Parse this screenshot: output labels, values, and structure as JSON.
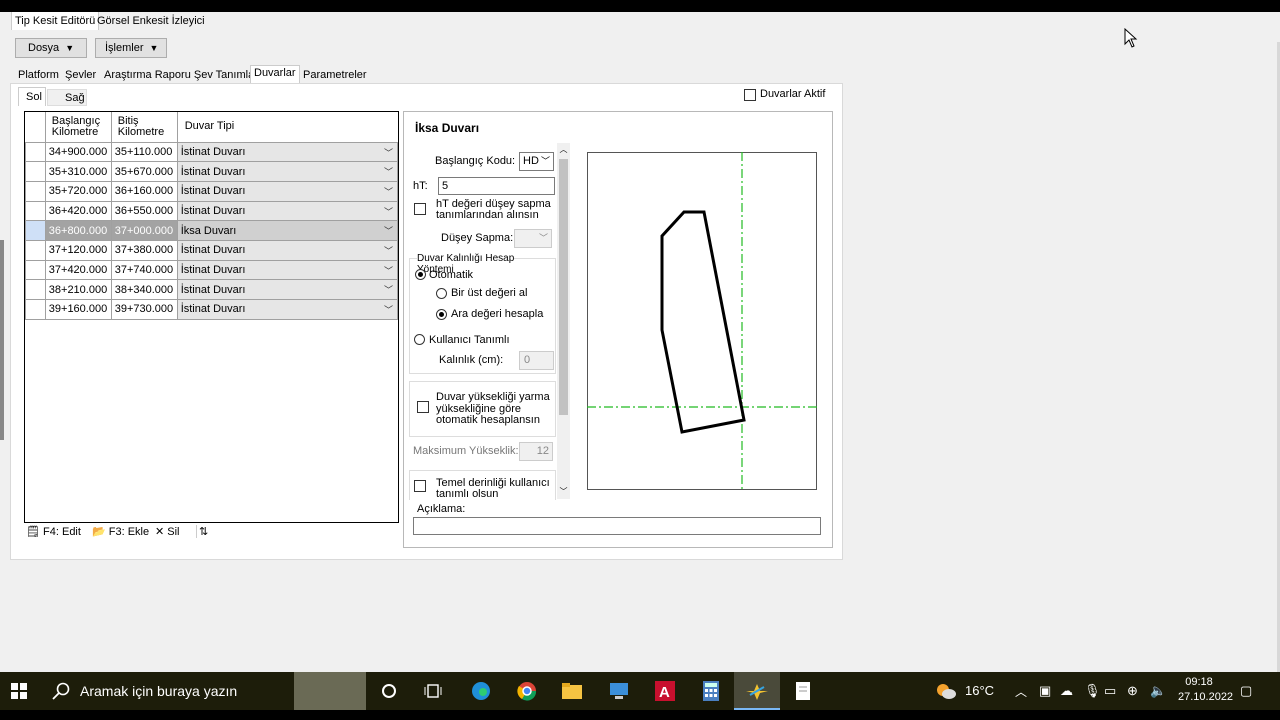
{
  "window_tabs": [
    "Tip Kesit Editörü",
    "Görsel Enkesit İzleyici"
  ],
  "toolbar": {
    "file": "Dosya",
    "actions": "İşlemler"
  },
  "section_tabs": [
    "Platform",
    "Şevler",
    "Araştırma Raporu Şev Tanımları",
    "Duvarlar",
    "Parametreler"
  ],
  "side_tabs": [
    "Sol",
    "Sağ"
  ],
  "walls_active_label": "Duvarlar Aktif",
  "grid": {
    "headers": {
      "start": "Başlangıç\nKilometre",
      "end": "Bitiş\nKilometre",
      "type": "Duvar Tipi"
    },
    "rows": [
      {
        "start": "34+900.000",
        "end": "35+110.000",
        "type": "İstinat Duvarı"
      },
      {
        "start": "35+310.000",
        "end": "35+670.000",
        "type": "İstinat Duvarı"
      },
      {
        "start": "35+720.000",
        "end": "36+160.000",
        "type": "İstinat Duvarı"
      },
      {
        "start": "36+420.000",
        "end": "36+550.000",
        "type": "İstinat Duvarı"
      },
      {
        "start": "36+800.000",
        "end": "37+000.000",
        "type": "İksa Duvarı"
      },
      {
        "start": "37+120.000",
        "end": "37+380.000",
        "type": "İstinat Duvarı"
      },
      {
        "start": "37+420.000",
        "end": "37+740.000",
        "type": "İstinat Duvarı"
      },
      {
        "start": "38+210.000",
        "end": "38+340.000",
        "type": "İstinat Duvarı"
      },
      {
        "start": "39+160.000",
        "end": "39+730.000",
        "type": "İstinat Duvarı"
      }
    ]
  },
  "grid_actions": {
    "edit": "F4: Edit",
    "add": "F3: Ekle",
    "delete": "Sil"
  },
  "editor": {
    "title": "İksa Duvarı",
    "start_code_label": "Başlangıç Kodu:",
    "start_code_value": "HD",
    "ht_label": "hT:",
    "ht_value": "5",
    "ht_from_vertical": "hT değeri düşey sapma\ntanımlarından alınsın",
    "vertical_offset_label": "Düşey Sapma:",
    "thickness_method_label": "Duvar Kalınlığı Hesap\nYöntemi",
    "auto_label": "Otomatik",
    "upper_value_label": "Bir üst değeri al",
    "interpolate_label": "Ara değeri hesapla",
    "user_defined_label": "Kullanıcı Tanımlı",
    "thickness_label": "Kalınlık (cm):",
    "thickness_value": "0",
    "auto_height_label": "Duvar yüksekliği yarma\nyüksekliğine göre\notomatik hesaplansın",
    "max_height_label": "Maksimum Yükseklik:",
    "max_height_value": "12",
    "foundation_label": "Temel derinliği kullanıcı\ntanımlı olsun",
    "description_label": "Açıklama:"
  },
  "taskbar": {
    "search_placeholder": "Aramak için buraya yazın",
    "weather": "16°C",
    "time": "09:18",
    "date": "27.10.2022"
  }
}
